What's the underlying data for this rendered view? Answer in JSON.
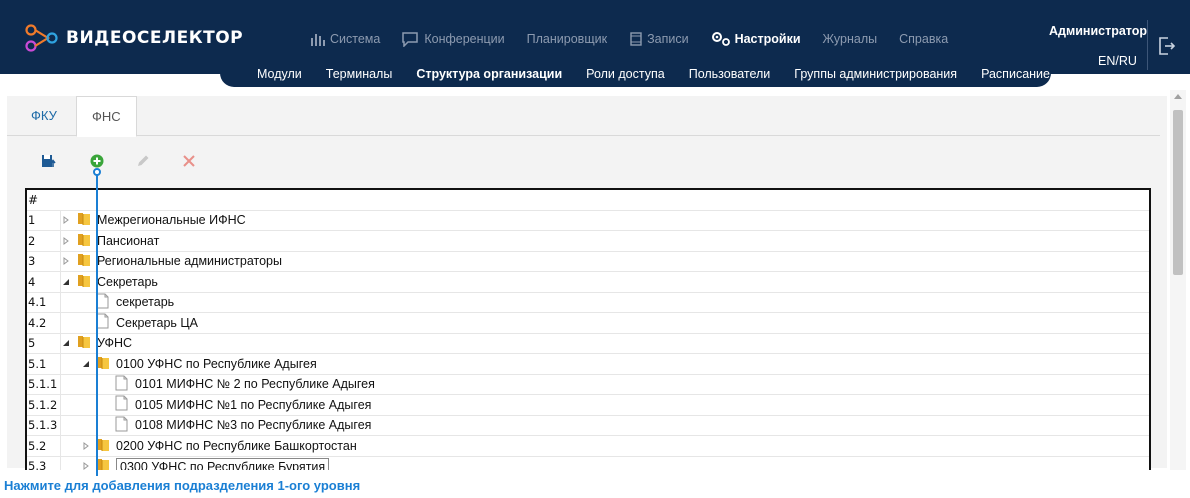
{
  "brand": {
    "name": "ВИДЕОСЕЛЕКТОР"
  },
  "main_nav": [
    {
      "label": "Система",
      "icon": "bar-chart-icon",
      "active": false
    },
    {
      "label": "Конференции",
      "icon": "chat-bubble-icon",
      "active": false
    },
    {
      "label": "Планировщик",
      "icon": "",
      "active": false
    },
    {
      "label": "Записи",
      "icon": "film-icon",
      "active": false
    },
    {
      "label": "Настройки",
      "icon": "gears-icon",
      "active": true
    },
    {
      "label": "Журналы",
      "icon": "",
      "active": false
    },
    {
      "label": "Справка",
      "icon": "",
      "active": false
    }
  ],
  "sub_nav": [
    {
      "label": "Модули",
      "active": false
    },
    {
      "label": "Терминалы",
      "active": false
    },
    {
      "label": "Структура организации",
      "active": true
    },
    {
      "label": "Роли доступа",
      "active": false
    },
    {
      "label": "Пользователи",
      "active": false
    },
    {
      "label": "Группы администрирования",
      "active": false
    },
    {
      "label": "Расписание",
      "active": false
    }
  ],
  "user": {
    "name": "Администратор",
    "lang": "EN/RU"
  },
  "tabs": [
    {
      "label": "ФКУ",
      "active": false
    },
    {
      "label": "ФНС",
      "active": true
    }
  ],
  "toolbar": {
    "save_icon": "save-upload-icon",
    "add_icon": "add-circle-icon",
    "edit_icon": "pencil-icon",
    "delete_icon": "close-x-icon"
  },
  "tree": {
    "header": "#",
    "rows": [
      {
        "num": "1",
        "level": 0,
        "type": "folder",
        "state": "collapsed",
        "label": "Межрегиональные ИФНС"
      },
      {
        "num": "2",
        "level": 0,
        "type": "folder",
        "state": "collapsed",
        "label": "Пансионат"
      },
      {
        "num": "3",
        "level": 0,
        "type": "folder",
        "state": "collapsed",
        "label": "Региональные администраторы"
      },
      {
        "num": "4",
        "level": 0,
        "type": "folder",
        "state": "expanded",
        "label": "Секретарь"
      },
      {
        "num": "4.1",
        "level": 1,
        "type": "file",
        "state": "",
        "label": "секретарь"
      },
      {
        "num": "4.2",
        "level": 1,
        "type": "file",
        "state": "",
        "label": "Секретарь ЦА"
      },
      {
        "num": "5",
        "level": 0,
        "type": "folder",
        "state": "expanded",
        "label": "УФНС"
      },
      {
        "num": "5.1",
        "level": 1,
        "type": "folder",
        "state": "expanded",
        "label": "0100 УФНС по Республике Адыгея"
      },
      {
        "num": "5.1.1",
        "level": 2,
        "type": "file",
        "state": "",
        "label": "0101 МИФНС № 2 по Республике Адыгея"
      },
      {
        "num": "5.1.2",
        "level": 2,
        "type": "file",
        "state": "",
        "label": "0105 МИФНС №1 по Республике Адыгея"
      },
      {
        "num": "5.1.3",
        "level": 2,
        "type": "file",
        "state": "",
        "label": "0108 МИФНС №3 по Республике Адыгея"
      },
      {
        "num": "5.2",
        "level": 1,
        "type": "folder",
        "state": "collapsed",
        "label": "0200 УФНС по Республике Башкортостан"
      },
      {
        "num": "5.3",
        "level": 1,
        "type": "folder",
        "state": "collapsed",
        "label": "0300 УФНС по Республике Бурятия",
        "selected": true
      }
    ]
  },
  "callout": {
    "text": "Нажмите для добавления подразделения 1-ого уровня"
  }
}
